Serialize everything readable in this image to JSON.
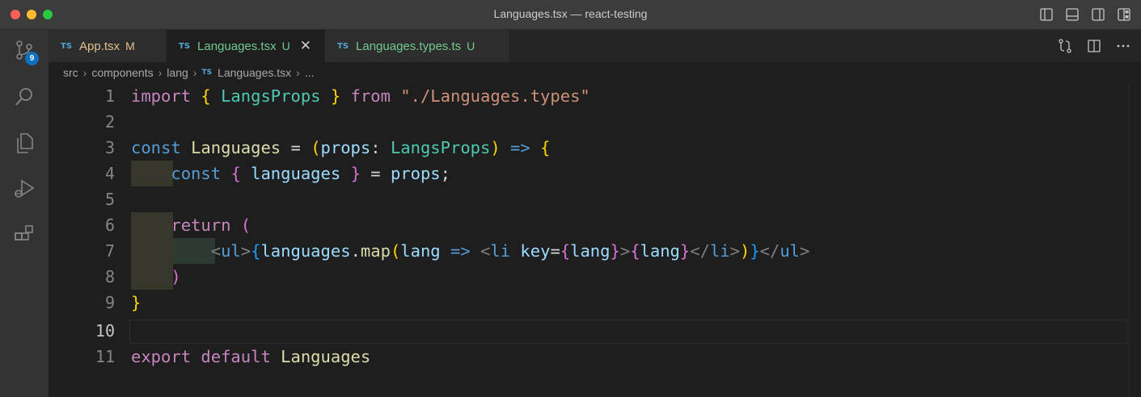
{
  "window": {
    "title": "Languages.tsx — react-testing"
  },
  "activity": {
    "scm_badge": "9"
  },
  "tabs": [
    {
      "badge": "TS",
      "label": "App.tsx",
      "status": "M"
    },
    {
      "badge": "TS",
      "label": "Languages.tsx",
      "status": "U",
      "close": "✕"
    },
    {
      "badge": "TS",
      "label": "Languages.types.ts",
      "status": "U"
    }
  ],
  "breadcrumb": {
    "parts": [
      "src",
      "components",
      "lang"
    ],
    "file_badge": "TS",
    "file": "Languages.tsx",
    "more": "..."
  },
  "editor": {
    "line_numbers": [
      "1",
      "2",
      "3",
      "4",
      "5",
      "6",
      "7",
      "8",
      "9",
      "10",
      "11"
    ],
    "current_line": "10",
    "code": {
      "l1": {
        "import": "import",
        "ob": "{",
        "name": "LangsProps",
        "cb": "}",
        "from": "from",
        "path": "\"./Languages.types\""
      },
      "l3": {
        "const": "const",
        "name": "Languages",
        "eq": "=",
        "op": "(",
        "param": "props",
        "colon": ":",
        "type": "LangsProps",
        "cp": ")",
        "arrow": "=>",
        "ob": "{"
      },
      "l4": {
        "const": "const",
        "ob": "{",
        "name": "languages",
        "cb": "}",
        "eq": "=",
        "rhs": "props",
        "semi": ";"
      },
      "l6": {
        "return": "return",
        "op": "("
      },
      "l7": {
        "lt1": "<",
        "ul": "ul",
        "gt1": ">",
        "ob1": "{",
        "obj": "languages",
        "dot": ".",
        "method": "map",
        "op": "(",
        "param": "lang",
        "arrow": "=>",
        "lt2": "<",
        "li": "li",
        "attr": "key",
        "eq": "=",
        "ob2": "{",
        "val1": "lang",
        "cb2": "}",
        "gt2": ">",
        "ob3": "{",
        "val2": "lang",
        "cb3": "}",
        "close_li": "</",
        "li2": "li",
        "gt3": ">",
        "cp": ")",
        "cb1": "}",
        "close_ul": "</",
        "ul2": "ul",
        "gt4": ">"
      },
      "l8": {
        "cp": ")"
      },
      "l9": {
        "cb": "}"
      },
      "l11": {
        "export": "export",
        "default": "default",
        "name": "Languages"
      }
    }
  }
}
